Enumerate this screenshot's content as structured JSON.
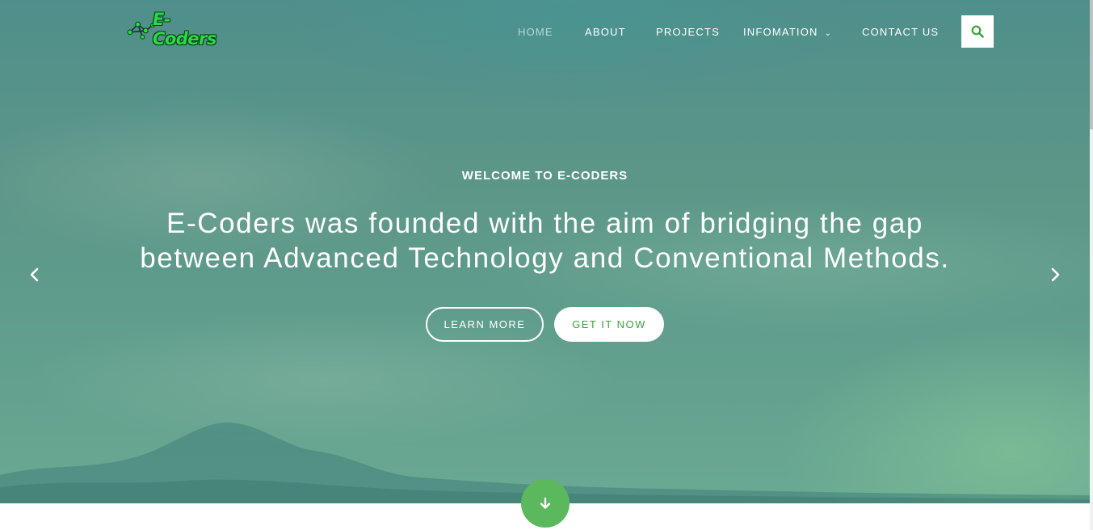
{
  "brand": {
    "logo_text": "E-Coders",
    "logo_icon": "network-nodes-icon",
    "logo_color": "#2bd94a"
  },
  "nav": {
    "items": [
      {
        "label": "HOME",
        "active": true
      },
      {
        "label": "ABOUT",
        "active": false
      },
      {
        "label": "PROJECTS",
        "active": false
      },
      {
        "label": "INFOMATION",
        "active": false,
        "dropdown": true
      },
      {
        "label": "CONTACT US",
        "active": false
      }
    ],
    "search_icon": "search-icon"
  },
  "hero": {
    "subtitle": "WELCOME TO E-CODERS",
    "headline_line1": "E-Coders was founded with the aim of bridging the gap",
    "headline_line2": "between Advanced Technology and Conventional Methods.",
    "learn_more_label": "LEARN MORE",
    "get_it_now_label": "GET IT NOW",
    "prev_icon": "chevron-left-icon",
    "next_icon": "chevron-right-icon",
    "scroll_down_icon": "arrow-down-icon"
  },
  "colors": {
    "accent_green": "#5cb85c",
    "button_text_green": "#3aa33c",
    "hero_overlay": "#5c9688"
  }
}
